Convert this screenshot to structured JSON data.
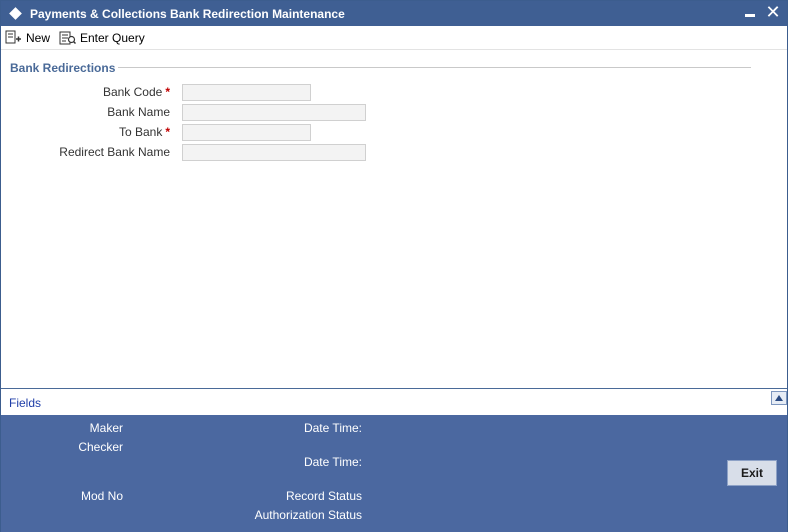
{
  "window": {
    "title": "Payments & Collections Bank Redirection Maintenance"
  },
  "toolbar": {
    "new_label": "New",
    "enter_query_label": "Enter Query"
  },
  "section": {
    "title": "Bank Redirections"
  },
  "form": {
    "bank_code": {
      "label": "Bank Code",
      "required": "*",
      "value": ""
    },
    "bank_name": {
      "label": "Bank Name",
      "value": ""
    },
    "to_bank": {
      "label": "To Bank",
      "required": "*",
      "value": ""
    },
    "redirect_bank_name": {
      "label": "Redirect Bank Name",
      "value": ""
    }
  },
  "fields_bar": {
    "title": "Fields"
  },
  "audit": {
    "maker": "Maker",
    "checker": "Checker",
    "date_time_1": "Date Time:",
    "date_time_2": "Date Time:",
    "mod_no": "Mod No",
    "record_status": "Record Status",
    "authorization_status": "Authorization Status",
    "exit_label": "Exit"
  },
  "colors": {
    "title_bar": "#3f5f93",
    "audit_panel": "#4b68a0",
    "section_title": "#4a6a98",
    "required": "#c00000"
  },
  "icons": {
    "title": "diamond-icon",
    "minimize": "minimize-icon",
    "close": "close-icon",
    "new": "new-document-icon",
    "enter_query": "enter-query-icon",
    "collapse": "collapse-up-icon"
  }
}
